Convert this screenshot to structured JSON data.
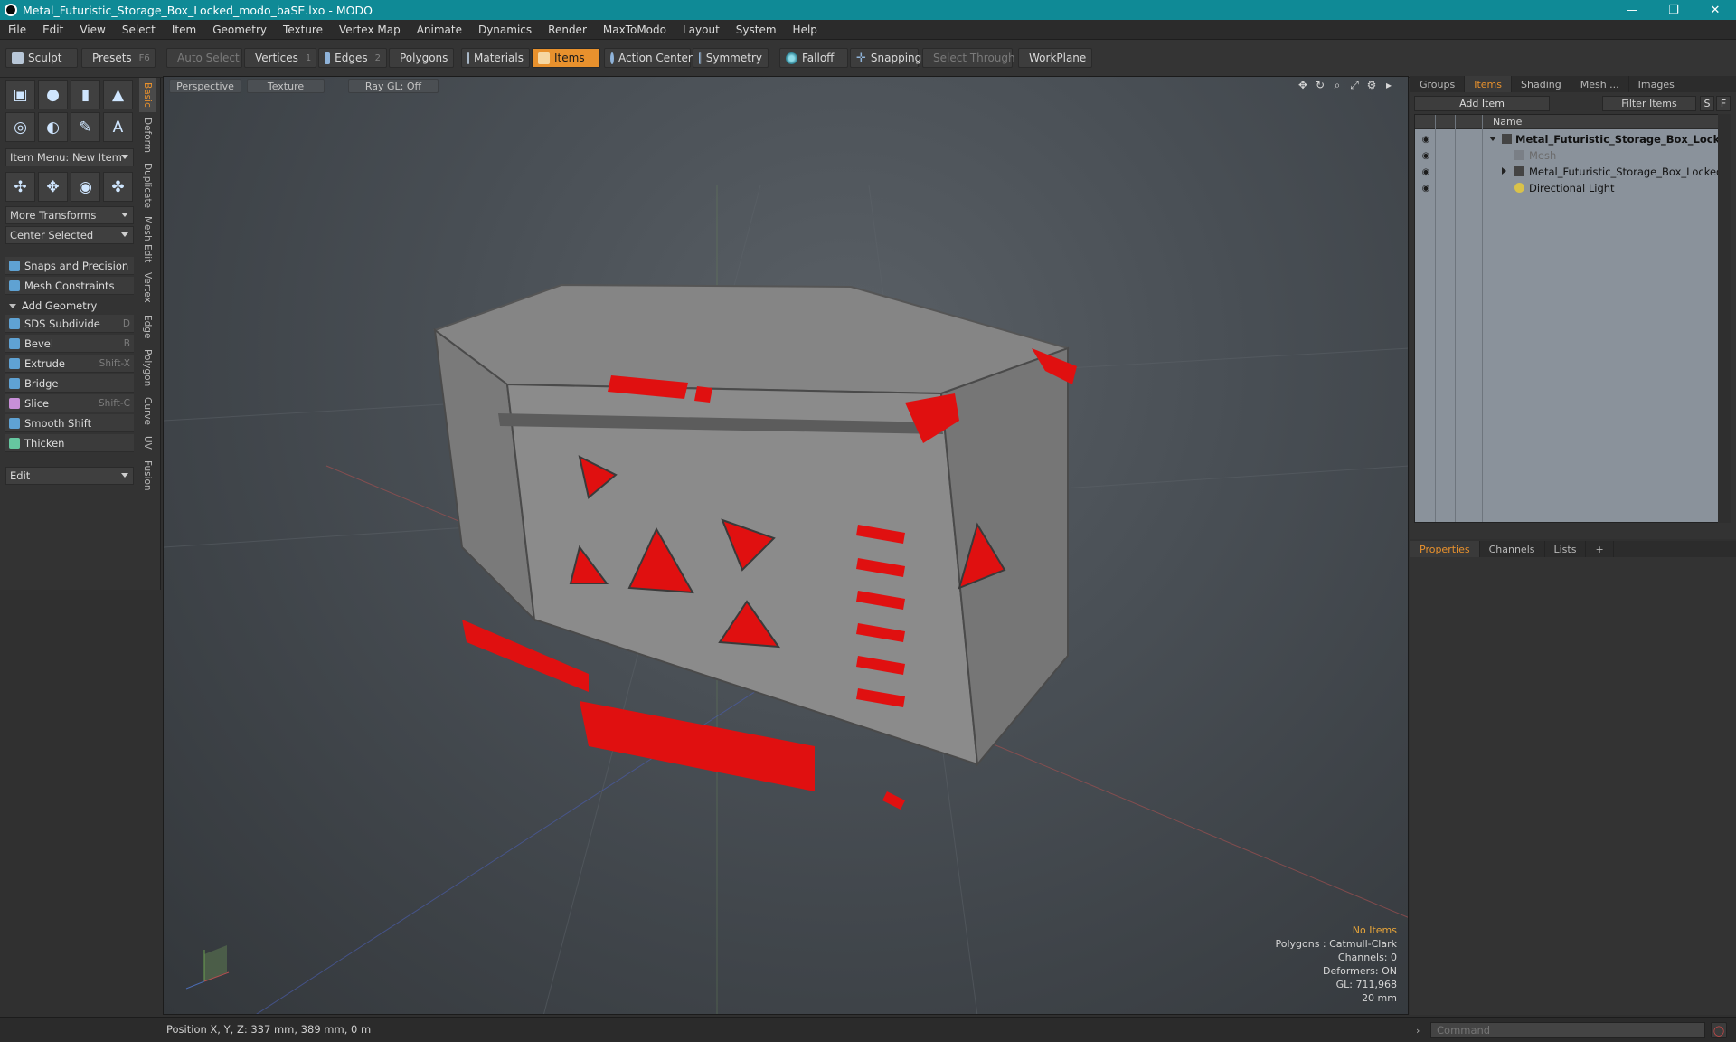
{
  "window": {
    "title": "Metal_Futuristic_Storage_Box_Locked_modo_baSE.lxo - MODO",
    "minimize": "—",
    "restore": "❐",
    "close": "✕"
  },
  "menu": [
    "File",
    "Edit",
    "View",
    "Select",
    "Item",
    "Geometry",
    "Texture",
    "Vertex Map",
    "Animate",
    "Dynamics",
    "Render",
    "MaxToModo",
    "Layout",
    "System",
    "Help"
  ],
  "toolbar": {
    "sculpt": "Sculpt",
    "presets": "Presets",
    "presets_key": "F6",
    "auto_select": "Auto Select",
    "vertices": "Vertices",
    "vertices_key": "1",
    "edges": "Edges",
    "edges_key": "2",
    "polygons": "Polygons",
    "materials": "Materials",
    "items": "Items",
    "action_center": "Action Center",
    "symmetry": "Symmetry",
    "falloff": "Falloff",
    "snapping": "Snapping",
    "select_through": "Select Through",
    "workplane": "WorkPlane"
  },
  "left": {
    "item_menu": "Item Menu: New Item",
    "more_transforms": "More Transforms",
    "center_selected": "Center Selected",
    "snaps": "Snaps and Precision",
    "mesh_constraints": "Mesh Constraints",
    "add_geometry": "Add Geometry",
    "tools": [
      {
        "label": "SDS Subdivide",
        "key": "D"
      },
      {
        "label": "Bevel",
        "key": "B"
      },
      {
        "label": "Extrude",
        "key": "Shift-X"
      },
      {
        "label": "Bridge",
        "key": ""
      },
      {
        "label": "Slice",
        "key": "Shift-C"
      },
      {
        "label": "Smooth Shift",
        "key": ""
      },
      {
        "label": "Thicken",
        "key": ""
      }
    ],
    "edit": "Edit",
    "vtabs": [
      "Basic",
      "Deform",
      "Duplicate",
      "Mesh Edit",
      "Vertex",
      "Edge",
      "Polygon",
      "Curve",
      "UV",
      "Fusion"
    ]
  },
  "viewport": {
    "perspective": "Perspective",
    "texture": "Texture",
    "raygl": "Ray GL: Off",
    "info": {
      "no_items": "No Items",
      "polygons": "Polygons : Catmull-Clark",
      "channels": "Channels: 0",
      "deformers": "Deformers: ON",
      "gl": "GL: 711,968",
      "scale": "20 mm"
    },
    "colors": {
      "accent_red": "#e01010",
      "metal": "#8a8a8a"
    }
  },
  "right": {
    "tabs": [
      "Groups",
      "Items",
      "Shading",
      "Mesh ...",
      "Images"
    ],
    "add_item": "Add Item",
    "filter_items": "Filter Items",
    "s_btn": "S",
    "f_btn": "F",
    "name_col": "Name",
    "rows": [
      {
        "label": "Metal_Futuristic_Storage_Box_Lock..."
      },
      {
        "label": "Mesh"
      },
      {
        "label": "Metal_Futuristic_Storage_Box_Locked"
      },
      {
        "label": "Directional Light"
      }
    ]
  },
  "props": {
    "tabs": [
      "Properties",
      "Channels",
      "Lists"
    ],
    "add": "+"
  },
  "status": {
    "position": "Position X, Y, Z:   337 mm, 389 mm, 0 m",
    "command_placeholder": "Command"
  }
}
